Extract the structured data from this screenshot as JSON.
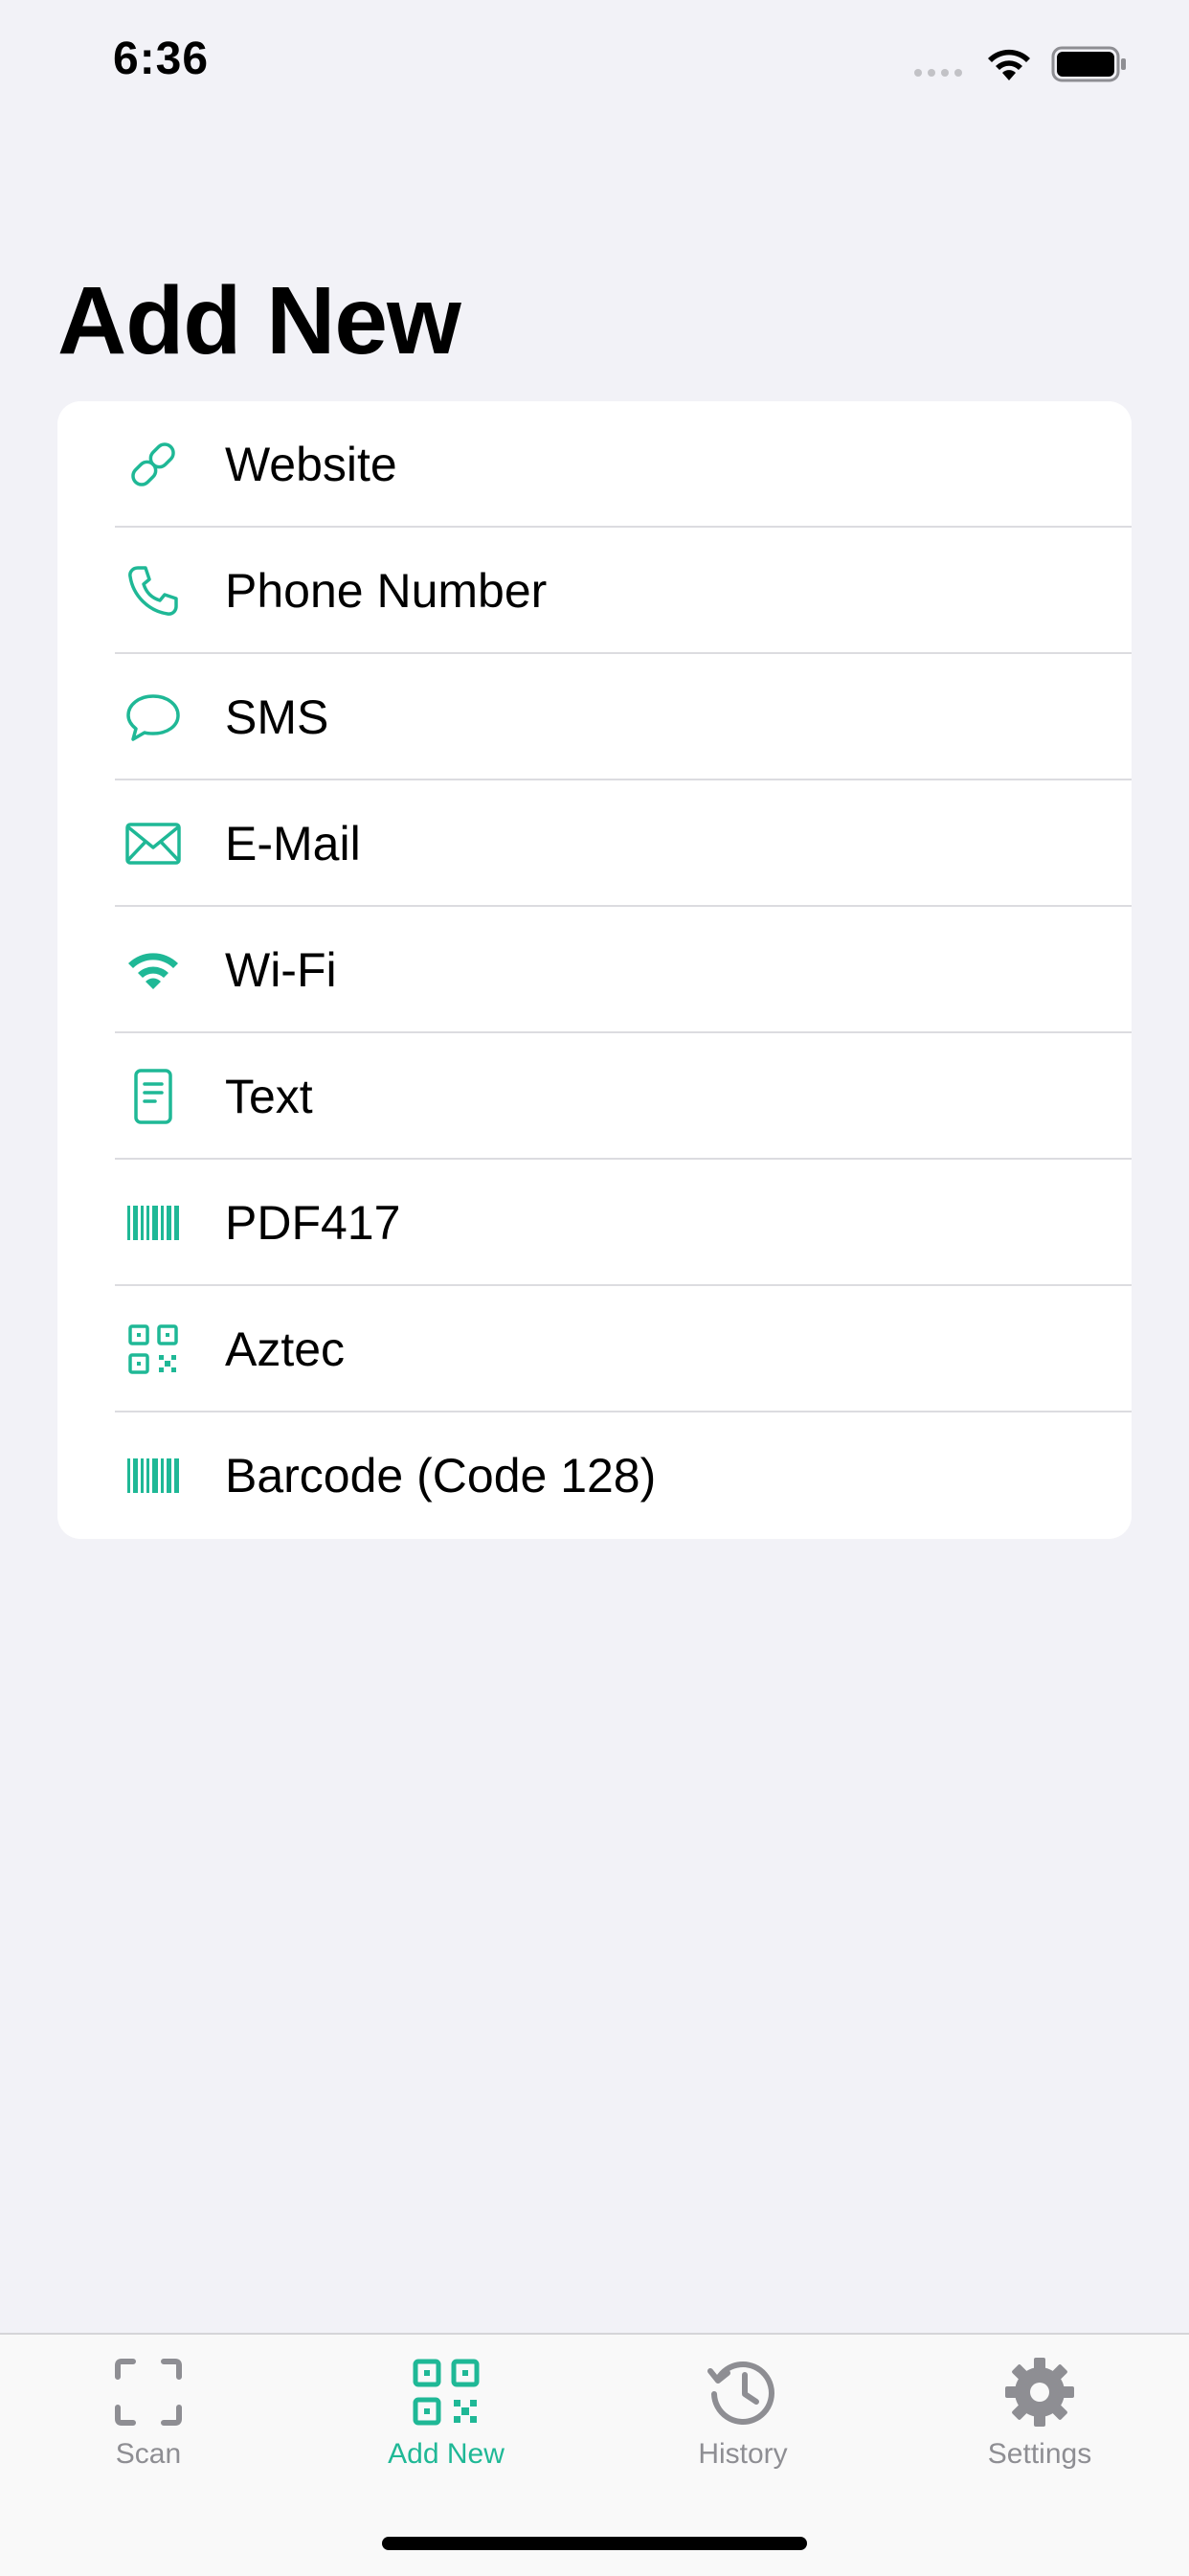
{
  "status_bar": {
    "time": "6:36"
  },
  "page_title": "Add New",
  "accent_color": "#1fb896",
  "items": [
    {
      "label": "Website",
      "icon": "link-icon"
    },
    {
      "label": "Phone Number",
      "icon": "phone-icon"
    },
    {
      "label": "SMS",
      "icon": "message-bubble-icon"
    },
    {
      "label": "E-Mail",
      "icon": "envelope-icon"
    },
    {
      "label": "Wi-Fi",
      "icon": "wifi-icon"
    },
    {
      "label": "Text",
      "icon": "document-icon"
    },
    {
      "label": "PDF417",
      "icon": "barcode-icon"
    },
    {
      "label": "Aztec",
      "icon": "qr-code-icon"
    },
    {
      "label": "Barcode (Code 128)",
      "icon": "barcode-icon"
    }
  ],
  "tab_bar": {
    "tabs": [
      {
        "label": "Scan",
        "icon": "scan-frame-icon",
        "active": false
      },
      {
        "label": "Add New",
        "icon": "qr-code-icon",
        "active": true
      },
      {
        "label": "History",
        "icon": "clock-history-icon",
        "active": false
      },
      {
        "label": "Settings",
        "icon": "gear-icon",
        "active": false
      }
    ]
  }
}
